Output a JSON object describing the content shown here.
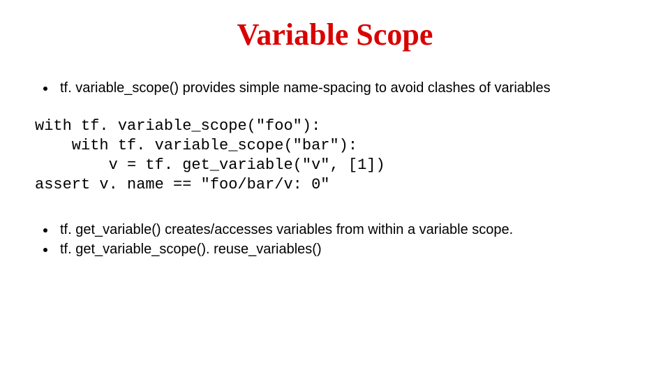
{
  "title": "Variable Scope",
  "title_color": "#d90000",
  "bullets_top": [
    "tf. variable_scope() provides simple name-spacing to avoid clashes of variables"
  ],
  "code": "with tf. variable_scope(\"foo\"):\n    with tf. variable_scope(\"bar\"):\n        v = tf. get_variable(\"v\", [1])\nassert v. name == \"foo/bar/v: 0\"",
  "bullets_bottom": [
    "tf. get_variable() creates/accesses variables from within a variable scope.",
    "tf. get_variable_scope(). reuse_variables()"
  ]
}
